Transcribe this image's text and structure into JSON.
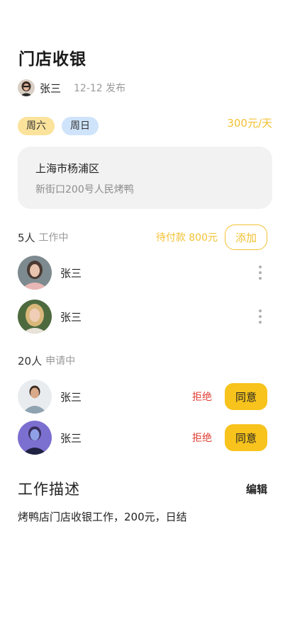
{
  "job": {
    "title": "门店收银",
    "publisher_name": "张三",
    "publish_date": "12-12 发布",
    "days": [
      "周六",
      "周日"
    ],
    "wage": "300元/天"
  },
  "address": {
    "district": "上海市杨浦区",
    "street": "新街口200号人民烤鸭"
  },
  "workers": {
    "count": "5人",
    "status_label": "工作中",
    "pending_payment": "待付款 800元",
    "add_label": "添加",
    "list": [
      {
        "name": "张三"
      },
      {
        "name": "张三"
      }
    ]
  },
  "applicants": {
    "count": "20人",
    "status_label": "申请中",
    "reject_label": "拒绝",
    "agree_label": "同意",
    "list": [
      {
        "name": "张三"
      },
      {
        "name": "张三"
      }
    ]
  },
  "description": {
    "title": "工作描述",
    "edit_label": "编辑",
    "text": "烤鸭店门店收银工作，200元，日结"
  },
  "colors": {
    "accent_yellow": "#f7c31c",
    "wage_yellow": "#f2c133",
    "reject_red": "#e03c31",
    "tag_yellow": "#fbe39c",
    "tag_blue": "#cfe4fb"
  }
}
